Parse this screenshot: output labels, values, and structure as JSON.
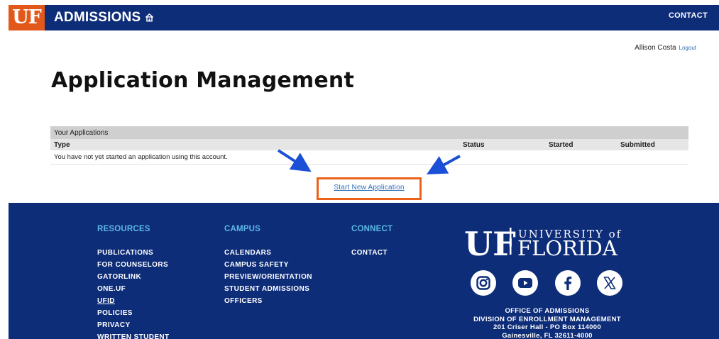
{
  "header": {
    "logo_text": "UF",
    "site_title": "ADMISSIONS",
    "home_icon": "home-icon",
    "contact": "CONTACT",
    "colors": {
      "navy": "#0e2d79",
      "orange": "#e2581a"
    }
  },
  "user": {
    "name": "Allison Costa",
    "logout": "Logout"
  },
  "main": {
    "title": "Application Management",
    "table": {
      "caption": "Your Applications",
      "columns": [
        "Type",
        "Status",
        "Started",
        "Submitted"
      ],
      "empty_message": "You have not yet started an application using this account."
    },
    "start_button": "Start New Application",
    "highlight_color": "#ec6219",
    "arrow_color": "#1a4fd6"
  },
  "footer": {
    "resources": {
      "title": "RESOURCES",
      "items": [
        "PUBLICATIONS",
        "FOR COUNSELORS",
        "GATORLINK",
        "ONE.UF",
        "UFID",
        "POLICIES",
        "PRIVACY",
        "WRITTEN STUDENT"
      ]
    },
    "campus": {
      "title": "CAMPUS",
      "items": [
        "CALENDARS",
        "CAMPUS SAFETY",
        "PREVIEW/ORIENTATION",
        "STUDENT ADMISSIONS",
        "OFFICERS"
      ]
    },
    "connect": {
      "title": "CONNECT",
      "items": [
        "CONTACT"
      ]
    },
    "wordmark": {
      "uf": "UF",
      "university_of": "UNIVERSITY of",
      "florida": "FLORIDA"
    },
    "social_icons": [
      "instagram-icon",
      "youtube-icon",
      "facebook-icon",
      "x-icon"
    ],
    "office": {
      "line1": "OFFICE OF ADMISSIONS",
      "line2": "DIVISION OF ENROLLMENT MANAGEMENT",
      "line3": "201 Criser Hall - PO Box 114000",
      "line4": "Gainesville, FL 32611-4000"
    }
  }
}
